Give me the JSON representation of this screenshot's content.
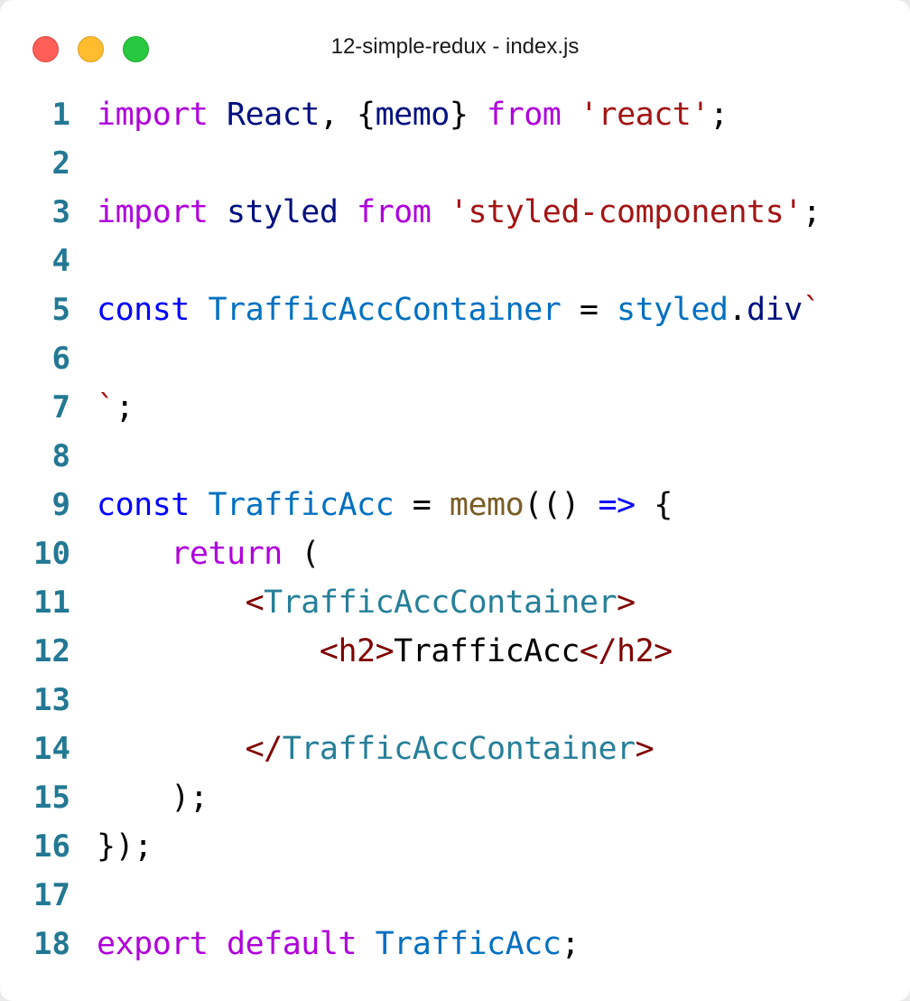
{
  "window": {
    "title": "12-simple-redux - index.js"
  },
  "editor": {
    "lines": [
      {
        "number": "1",
        "tokens": [
          {
            "text": "import",
            "kind": "kw"
          },
          {
            "text": " ",
            "kind": "plain"
          },
          {
            "text": "React",
            "kind": "id"
          },
          {
            "text": ", {",
            "kind": "plain"
          },
          {
            "text": "memo",
            "kind": "id"
          },
          {
            "text": "} ",
            "kind": "plain"
          },
          {
            "text": "from",
            "kind": "kw"
          },
          {
            "text": " ",
            "kind": "plain"
          },
          {
            "text": "'react'",
            "kind": "str"
          },
          {
            "text": ";",
            "kind": "plain"
          }
        ]
      },
      {
        "number": "2",
        "tokens": []
      },
      {
        "number": "3",
        "tokens": [
          {
            "text": "import",
            "kind": "kw"
          },
          {
            "text": " ",
            "kind": "plain"
          },
          {
            "text": "styled",
            "kind": "id"
          },
          {
            "text": " ",
            "kind": "plain"
          },
          {
            "text": "from",
            "kind": "kw"
          },
          {
            "text": " ",
            "kind": "plain"
          },
          {
            "text": "'styled-components'",
            "kind": "str"
          },
          {
            "text": ";",
            "kind": "plain"
          }
        ]
      },
      {
        "number": "4",
        "tokens": []
      },
      {
        "number": "5",
        "tokens": [
          {
            "text": "const",
            "kind": "decl"
          },
          {
            "text": " ",
            "kind": "plain"
          },
          {
            "text": "TrafficAccContainer",
            "kind": "prop"
          },
          {
            "text": " = ",
            "kind": "plain"
          },
          {
            "text": "styled",
            "kind": "prop"
          },
          {
            "text": ".",
            "kind": "plain"
          },
          {
            "text": "div",
            "kind": "id"
          },
          {
            "text": "`",
            "kind": "str"
          }
        ]
      },
      {
        "number": "6",
        "tokens": []
      },
      {
        "number": "7",
        "tokens": [
          {
            "text": "`",
            "kind": "str"
          },
          {
            "text": ";",
            "kind": "plain"
          }
        ]
      },
      {
        "number": "8",
        "tokens": []
      },
      {
        "number": "9",
        "tokens": [
          {
            "text": "const",
            "kind": "decl"
          },
          {
            "text": " ",
            "kind": "plain"
          },
          {
            "text": "TrafficAcc",
            "kind": "prop"
          },
          {
            "text": " = ",
            "kind": "plain"
          },
          {
            "text": "memo",
            "kind": "fn"
          },
          {
            "text": "(() ",
            "kind": "plain"
          },
          {
            "text": "=>",
            "kind": "decl"
          },
          {
            "text": " {",
            "kind": "plain"
          }
        ]
      },
      {
        "number": "10",
        "tokens": [
          {
            "text": "    ",
            "kind": "plain"
          },
          {
            "text": "return",
            "kind": "kw"
          },
          {
            "text": " (",
            "kind": "plain"
          }
        ]
      },
      {
        "number": "11",
        "tokens": [
          {
            "text": "        ",
            "kind": "plain"
          },
          {
            "text": "<",
            "kind": "tag"
          },
          {
            "text": "TrafficAccContainer",
            "kind": "type"
          },
          {
            "text": ">",
            "kind": "tag"
          }
        ]
      },
      {
        "number": "12",
        "tokens": [
          {
            "text": "            ",
            "kind": "plain"
          },
          {
            "text": "<h2>",
            "kind": "tag"
          },
          {
            "text": "TrafficAcc",
            "kind": "plain"
          },
          {
            "text": "</h2>",
            "kind": "tag"
          }
        ]
      },
      {
        "number": "13",
        "tokens": []
      },
      {
        "number": "14",
        "tokens": [
          {
            "text": "        ",
            "kind": "plain"
          },
          {
            "text": "</",
            "kind": "tag"
          },
          {
            "text": "TrafficAccContainer",
            "kind": "type"
          },
          {
            "text": ">",
            "kind": "tag"
          }
        ]
      },
      {
        "number": "15",
        "tokens": [
          {
            "text": "    ",
            "kind": "plain"
          },
          {
            "text": ");",
            "kind": "plain"
          }
        ]
      },
      {
        "number": "16",
        "tokens": [
          {
            "text": "});",
            "kind": "plain"
          }
        ]
      },
      {
        "number": "17",
        "tokens": []
      },
      {
        "number": "18",
        "tokens": [
          {
            "text": "export",
            "kind": "kw"
          },
          {
            "text": " ",
            "kind": "plain"
          },
          {
            "text": "default",
            "kind": "kw"
          },
          {
            "text": " ",
            "kind": "plain"
          },
          {
            "text": "TrafficAcc",
            "kind": "prop"
          },
          {
            "text": ";",
            "kind": "plain"
          }
        ]
      }
    ]
  },
  "colors": {
    "close": "#ff5f57",
    "minimize": "#febc2e",
    "maximize": "#28c840",
    "line_number": "#237893",
    "keyword": "#af00db",
    "declaration": "#0000ff",
    "identifier": "#001080",
    "string": "#a31515",
    "type": "#267f99",
    "property": "#0070c1",
    "function": "#795e26",
    "tag": "#800000"
  }
}
